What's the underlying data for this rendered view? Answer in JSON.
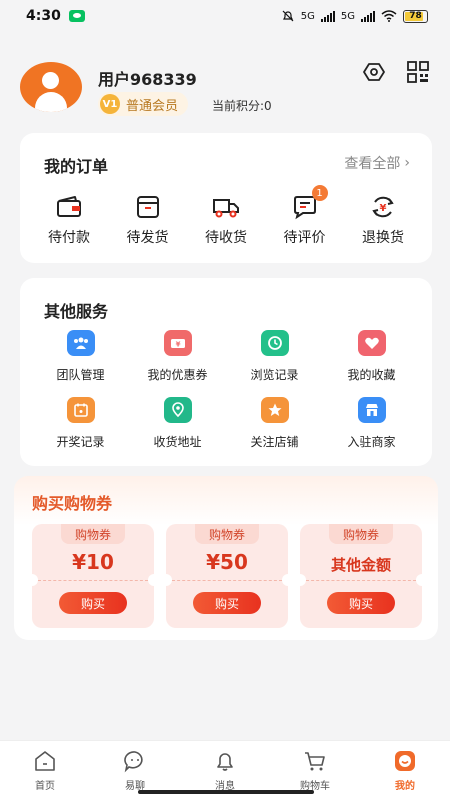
{
  "status_bar": {
    "time": "4:30",
    "battery": "78",
    "network1": "5G",
    "network2": "5G"
  },
  "profile": {
    "username": "用户968339",
    "level_badge": "V1",
    "level_name": "普通会员",
    "points_label": "当前积分:0"
  },
  "orders": {
    "title": "我的订单",
    "view_all": "查看全部",
    "items": [
      {
        "label": "待付款",
        "icon": "wallet-icon"
      },
      {
        "label": "待发货",
        "icon": "box-icon"
      },
      {
        "label": "待收货",
        "icon": "truck-icon"
      },
      {
        "label": "待评价",
        "icon": "comment-icon",
        "badge": "1"
      },
      {
        "label": "退换货",
        "icon": "refund-icon"
      }
    ]
  },
  "services": {
    "title": "其他服务",
    "items": [
      {
        "label": "团队管理",
        "icon": "team-icon",
        "color": "#3a8ef6"
      },
      {
        "label": "我的优惠券",
        "icon": "coupon-icon",
        "color": "#f06a6a"
      },
      {
        "label": "浏览记录",
        "icon": "clock-icon",
        "color": "#23c08a"
      },
      {
        "label": "我的收藏",
        "icon": "heart-icon",
        "color": "#f0646e"
      },
      {
        "label": "开奖记录",
        "icon": "calendar-icon",
        "color": "#f5943a"
      },
      {
        "label": "收货地址",
        "icon": "location-icon",
        "color": "#22b88a"
      },
      {
        "label": "关注店铺",
        "icon": "star-icon",
        "color": "#f5943a"
      },
      {
        "label": "入驻商家",
        "icon": "store-icon",
        "color": "#3a8ef6"
      }
    ]
  },
  "coupons": {
    "title": "购买购物券",
    "items": [
      {
        "tag": "购物券",
        "amount": "¥10",
        "button": "购买"
      },
      {
        "tag": "购物券",
        "amount": "¥50",
        "button": "购买"
      },
      {
        "tag": "购物券",
        "amount": "其他金额",
        "button": "购买"
      }
    ]
  },
  "tabbar": {
    "items": [
      {
        "label": "首页",
        "icon": "home-icon"
      },
      {
        "label": "易聊",
        "icon": "chat-icon"
      },
      {
        "label": "消息",
        "icon": "bell-icon"
      },
      {
        "label": "购物车",
        "icon": "cart-icon"
      },
      {
        "label": "我的",
        "icon": "profile-icon",
        "active": true
      }
    ]
  },
  "colors": {
    "accent": "#f06a2a",
    "coupon_red": "#d8371e",
    "avatar_orange": "#f07423"
  }
}
